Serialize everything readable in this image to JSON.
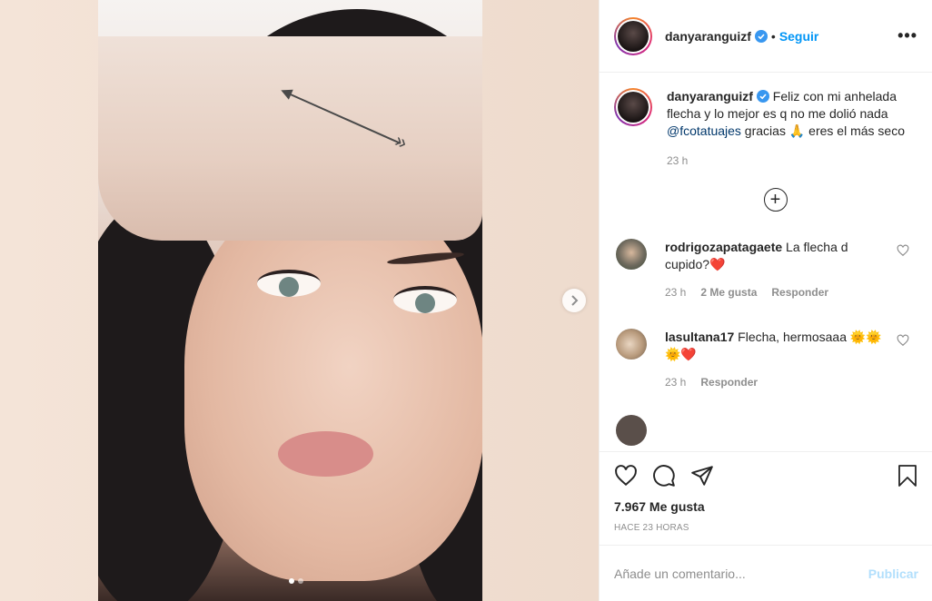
{
  "post": {
    "username": "danyaranguizf",
    "separator": "•",
    "follow_label": "Seguir",
    "more_icon": "•••",
    "caption_text": "Feliz con mi anhelada flecha y lo mejor es q no me dolió nada ",
    "caption_mention": "@fcotatuajes",
    "caption_after": " gracias 🙏 eres el más seco",
    "caption_time": "23 h",
    "load_more_icon": "+"
  },
  "comments": [
    {
      "username": "rodrigozapatagaete",
      "text": "La flecha d cupido?❤️",
      "time": "23 h",
      "likes": "2 Me gusta",
      "reply": "Responder"
    },
    {
      "username": "lasultana17",
      "text": "Flecha, hermosaaa 🌞🌞🌞❤️",
      "time": "23 h",
      "reply": "Responder"
    }
  ],
  "actions": {
    "likes": "7.967 Me gusta",
    "posted": "HACE 23 HORAS"
  },
  "add_comment": {
    "placeholder": "Añade un comentario...",
    "publish_label": "Publicar"
  },
  "carousel": {
    "current": 1,
    "total": 2
  },
  "colors": {
    "accent": "#0095f6",
    "mention": "#00376b",
    "muted": "#8e8e8e",
    "publish_disabled": "#b2dffc"
  }
}
